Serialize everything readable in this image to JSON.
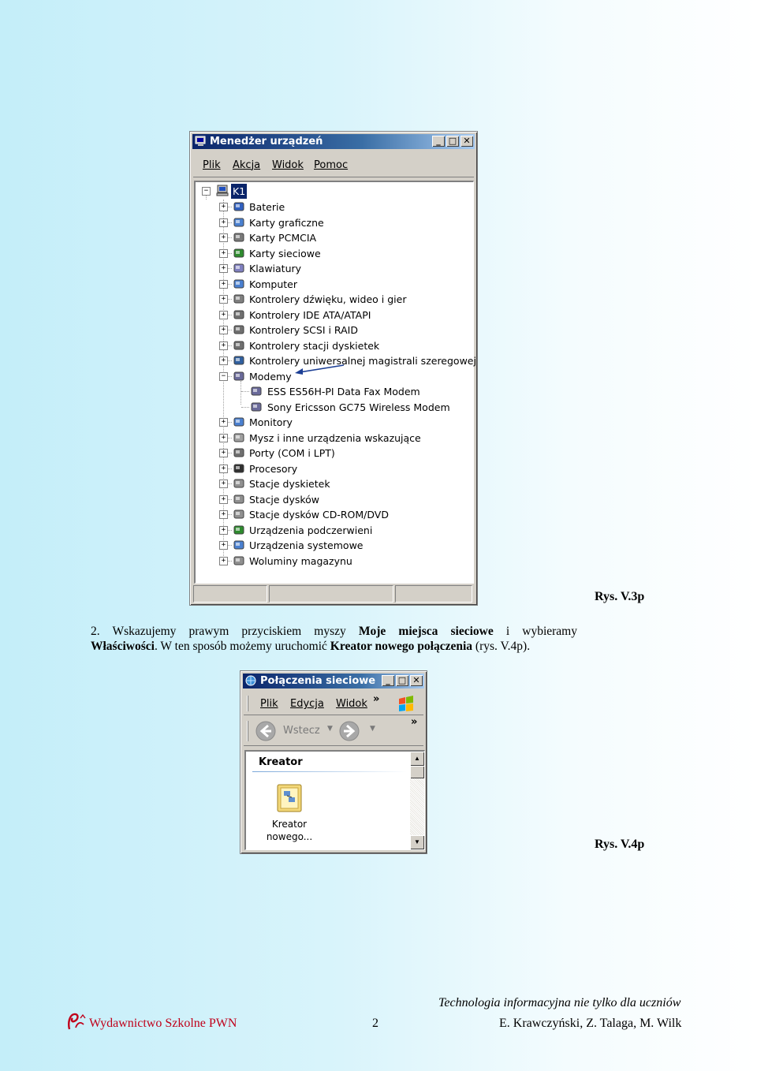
{
  "figure1": {
    "title": "Menedżer urządzeń",
    "menu": [
      "Plik",
      "Akcja",
      "Widok",
      "Pomoc"
    ],
    "root": "K1",
    "categories": [
      {
        "label": "Baterie",
        "icon": "battery-icon",
        "expanded": false
      },
      {
        "label": "Karty graficzne",
        "icon": "display-adapter-icon",
        "expanded": false
      },
      {
        "label": "Karty PCMCIA",
        "icon": "pcmcia-icon",
        "expanded": false
      },
      {
        "label": "Karty sieciowe",
        "icon": "network-card-icon",
        "expanded": false
      },
      {
        "label": "Klawiatury",
        "icon": "keyboard-icon",
        "expanded": false
      },
      {
        "label": "Komputer",
        "icon": "computer-icon",
        "expanded": false
      },
      {
        "label": "Kontrolery dźwięku, wideo i gier",
        "icon": "sound-icon",
        "expanded": false
      },
      {
        "label": "Kontrolery IDE ATA/ATAPI",
        "icon": "ide-controller-icon",
        "expanded": false
      },
      {
        "label": "Kontrolery SCSI i RAID",
        "icon": "scsi-controller-icon",
        "expanded": false
      },
      {
        "label": "Kontrolery stacji dyskietek",
        "icon": "floppy-controller-icon",
        "expanded": false
      },
      {
        "label": "Kontrolery uniwersalnej magistrali szeregowej",
        "icon": "usb-icon",
        "expanded": false
      },
      {
        "label": "Modemy",
        "icon": "modem-icon",
        "expanded": true,
        "children": [
          "ESS ES56H-PI Data Fax Modem",
          "Sony Ericsson GC75 Wireless Modem"
        ]
      },
      {
        "label": "Monitory",
        "icon": "monitor-icon",
        "expanded": false
      },
      {
        "label": "Mysz i inne urządzenia wskazujące",
        "icon": "mouse-icon",
        "expanded": false
      },
      {
        "label": "Porty (COM i LPT)",
        "icon": "port-icon",
        "expanded": false
      },
      {
        "label": "Procesory",
        "icon": "processor-icon",
        "expanded": false
      },
      {
        "label": "Stacje dyskietek",
        "icon": "floppy-drive-icon",
        "expanded": false
      },
      {
        "label": "Stacje dysków",
        "icon": "disk-drive-icon",
        "expanded": false
      },
      {
        "label": "Stacje dysków CD-ROM/DVD",
        "icon": "cdrom-icon",
        "expanded": false
      },
      {
        "label": "Urządzenia podczerwieni",
        "icon": "infrared-icon",
        "expanded": false
      },
      {
        "label": "Urządzenia systemowe",
        "icon": "system-device-icon",
        "expanded": false
      },
      {
        "label": "Woluminy magazynu",
        "icon": "storage-volume-icon",
        "expanded": false
      }
    ],
    "caption": "Rys. V.3p"
  },
  "paragraph": {
    "line1": [
      {
        "t": "2. Wskazujemy prawym przyciskiem myszy ",
        "b": false
      },
      {
        "t": "Moje miejsca sieciowe",
        "b": true
      },
      {
        "t": " i wybieramy",
        "b": false
      }
    ],
    "line2": [
      {
        "t": "Właściwości",
        "b": true
      },
      {
        "t": ". W ten sposób możemy uruchomić ",
        "b": false
      },
      {
        "t": "Kreator nowego połączenia",
        "b": true
      },
      {
        "t": " (rys. V.4p).",
        "b": false
      }
    ]
  },
  "figure2": {
    "title": "Połączenia sieciowe",
    "menu": [
      "Plik",
      "Edycja",
      "Widok"
    ],
    "menu_more": "»",
    "back_label": "Wstecz",
    "toolbar_more": "»",
    "group_header": "Kreator",
    "item_label_line1": "Kreator",
    "item_label_line2": "nowego...",
    "caption": "Rys. V.4p"
  },
  "footer": {
    "publisher": "Wydawnictwo Szkolne PWN",
    "page_number": "2",
    "book_title": "Technologia informacyjna nie tylko dla uczniów",
    "authors": "E. Krawczyński, Z. Talaga, M. Wilk"
  }
}
